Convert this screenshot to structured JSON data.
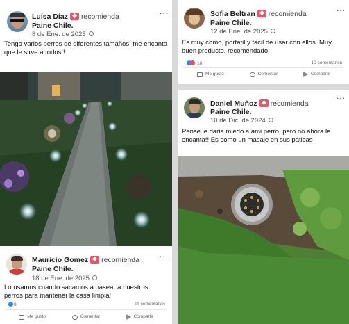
{
  "recommend_label": "recomienda",
  "page_name": "Paine Chile.",
  "more_glyph": "...",
  "action_labels": {
    "like": "Me gusto",
    "comment": "Comentar",
    "share": "Compartir"
  },
  "posts": [
    {
      "author": "Luisa Diaz",
      "date": "8 de Ene. de 2025",
      "text": "Tengo varios perros de diferentes tamaños, me encanta que le sirve a todos!!"
    },
    {
      "author": "Sofia Beltran",
      "date": "12 de Ene. de 2025",
      "text": "Es muy como, portatil y facil de usar con ellos. Muy buen producto, recomendado",
      "reactions": "10",
      "comments": "10 comentarios"
    },
    {
      "author": "Daniel Muñoz",
      "date": "10 de Dic. de 2024",
      "text": "Pense le daria miedo a ami perro, pero no ahora le encanta!! Es como un masaje en sus paticas"
    },
    {
      "author": "Mauricio Gomez",
      "date": "18 de Ene. de 2025",
      "text": "Lo usamos cuando sacamos a pasear a nuestros perros para mantener la casa limpia!",
      "reactions": "9",
      "comments": "11 comentarios"
    }
  ],
  "colors": {
    "recommend_badge": "#e4576b",
    "reaction_like": "#2d88ff",
    "reaction_love": "#f04c5c"
  },
  "icons": [
    "globe-icon",
    "like-icon",
    "comment-icon",
    "share-icon",
    "recommend-icon",
    "more-icon"
  ]
}
